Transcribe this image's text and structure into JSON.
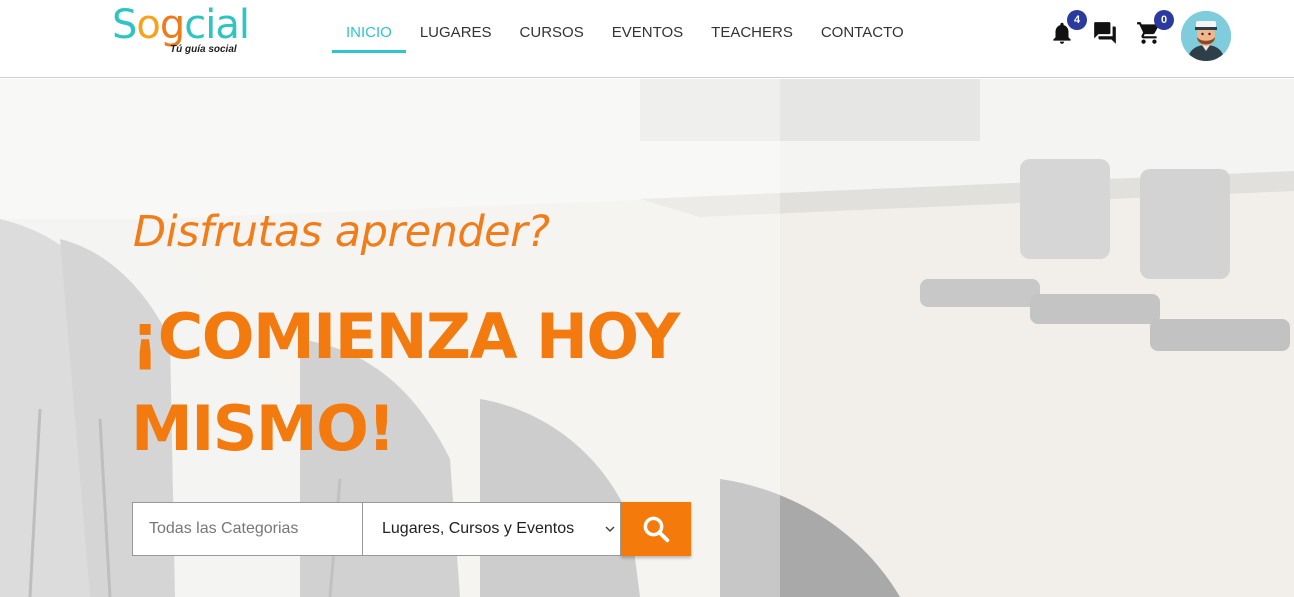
{
  "logo": {
    "word_s": "S",
    "word_o1": "o",
    "word_g": "g",
    "word_c": "c",
    "word_rest": "ial",
    "tagline": "Tú guía social"
  },
  "nav": {
    "items": [
      {
        "label": "INICIO",
        "active": true
      },
      {
        "label": "LUGARES",
        "active": false
      },
      {
        "label": "CURSOS",
        "active": false
      },
      {
        "label": "EVENTOS",
        "active": false
      },
      {
        "label": "TEACHERS",
        "active": false
      },
      {
        "label": "CONTACTO",
        "active": false
      }
    ]
  },
  "header_icons": {
    "notifications": {
      "icon": "bell-icon",
      "count": "4"
    },
    "messages": {
      "icon": "chat-icon"
    },
    "cart": {
      "icon": "cart-icon",
      "count": "0"
    },
    "avatar": {
      "icon": "user-avatar"
    }
  },
  "hero": {
    "subtitle": "Disfrutas aprender?",
    "title": "¡COMIENZA HOY MISMO!"
  },
  "search": {
    "category_placeholder": "Todas las Categorias",
    "type_select_value": "Lugares, Cursos y Eventos",
    "button_icon": "search-icon"
  },
  "colors": {
    "accent_teal": "#2ec4d0",
    "accent_orange": "#f37a0f",
    "badge_blue": "#2a3a9e"
  }
}
